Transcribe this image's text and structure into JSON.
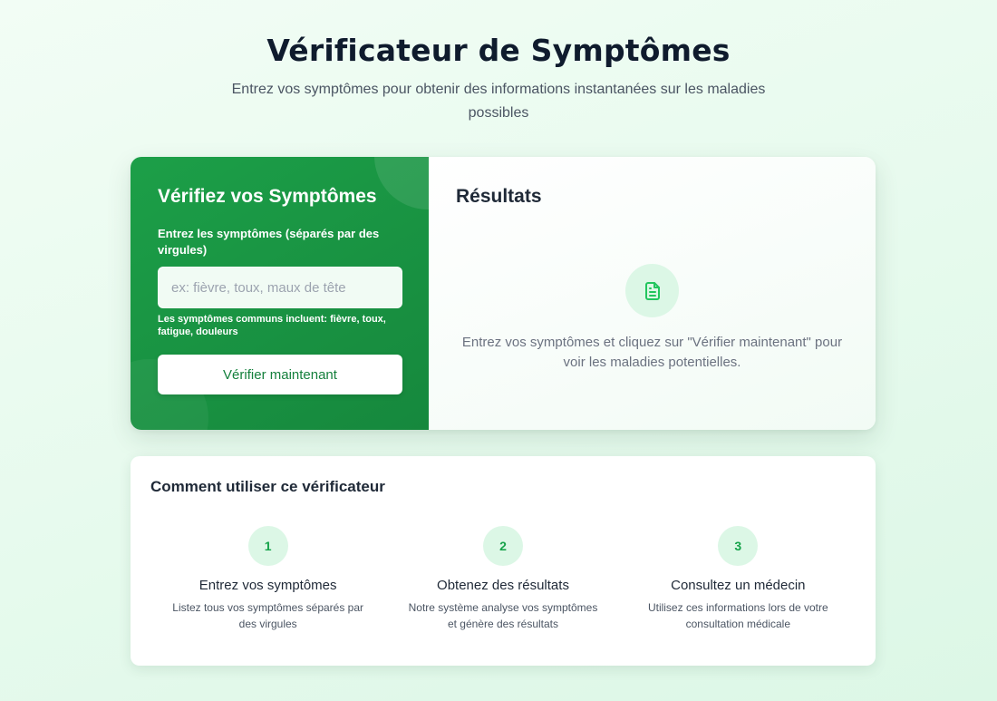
{
  "header": {
    "title": "Vérificateur de Symptômes",
    "subtitle": "Entrez vos symptômes pour obtenir des informations instantanées sur les maladies possibles"
  },
  "form": {
    "title": "Vérifiez vos Symptômes",
    "label": "Entrez les symptômes (séparés par des virgules)",
    "input_value": "",
    "placeholder": "ex: fièvre, toux, maux de tête",
    "hint": "Les symptômes communs incluent: fièvre, toux, fatigue, douleurs",
    "button_label": "Vérifier maintenant"
  },
  "results": {
    "title": "Résultats",
    "icon": "document-icon",
    "empty_message": "Entrez vos symptômes et cliquez sur \"Vérifier maintenant\" pour voir les maladies potentielles."
  },
  "howto": {
    "title": "Comment utiliser ce vérificateur",
    "steps": [
      {
        "number": "1",
        "title": "Entrez vos symptômes",
        "description": "Listez tous vos symptômes séparés par des virgules"
      },
      {
        "number": "2",
        "title": "Obtenez des résultats",
        "description": "Notre système analyse vos symptômes et génère des résultats"
      },
      {
        "number": "3",
        "title": "Consultez un médecin",
        "description": "Utilisez ces informations lors de votre consultation médicale"
      }
    ]
  },
  "colors": {
    "primary_green": "#16a34a",
    "panel_green": "#1c9f48",
    "light_green": "#dcf7e6",
    "page_background": "#ecfbf1",
    "text_dark": "#0f1b2d",
    "text_muted": "#6b7280"
  }
}
